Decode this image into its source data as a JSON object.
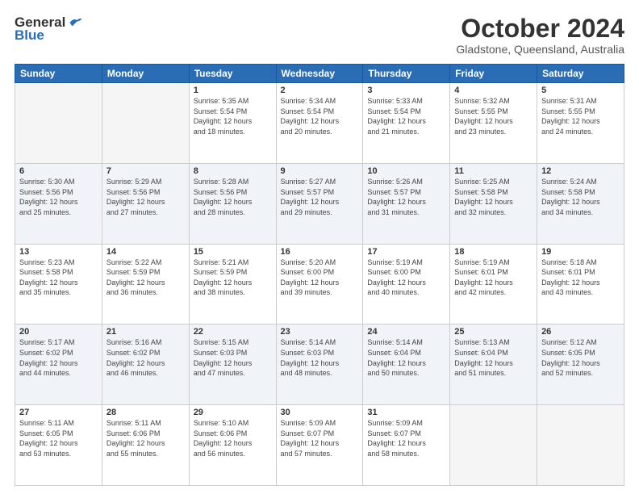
{
  "header": {
    "logo_general": "General",
    "logo_blue": "Blue",
    "month": "October 2024",
    "location": "Gladstone, Queensland, Australia"
  },
  "weekdays": [
    "Sunday",
    "Monday",
    "Tuesday",
    "Wednesday",
    "Thursday",
    "Friday",
    "Saturday"
  ],
  "weeks": [
    [
      {
        "day": "",
        "info": ""
      },
      {
        "day": "",
        "info": ""
      },
      {
        "day": "1",
        "info": "Sunrise: 5:35 AM\nSunset: 5:54 PM\nDaylight: 12 hours\nand 18 minutes."
      },
      {
        "day": "2",
        "info": "Sunrise: 5:34 AM\nSunset: 5:54 PM\nDaylight: 12 hours\nand 20 minutes."
      },
      {
        "day": "3",
        "info": "Sunrise: 5:33 AM\nSunset: 5:54 PM\nDaylight: 12 hours\nand 21 minutes."
      },
      {
        "day": "4",
        "info": "Sunrise: 5:32 AM\nSunset: 5:55 PM\nDaylight: 12 hours\nand 23 minutes."
      },
      {
        "day": "5",
        "info": "Sunrise: 5:31 AM\nSunset: 5:55 PM\nDaylight: 12 hours\nand 24 minutes."
      }
    ],
    [
      {
        "day": "6",
        "info": "Sunrise: 5:30 AM\nSunset: 5:56 PM\nDaylight: 12 hours\nand 25 minutes."
      },
      {
        "day": "7",
        "info": "Sunrise: 5:29 AM\nSunset: 5:56 PM\nDaylight: 12 hours\nand 27 minutes."
      },
      {
        "day": "8",
        "info": "Sunrise: 5:28 AM\nSunset: 5:56 PM\nDaylight: 12 hours\nand 28 minutes."
      },
      {
        "day": "9",
        "info": "Sunrise: 5:27 AM\nSunset: 5:57 PM\nDaylight: 12 hours\nand 29 minutes."
      },
      {
        "day": "10",
        "info": "Sunrise: 5:26 AM\nSunset: 5:57 PM\nDaylight: 12 hours\nand 31 minutes."
      },
      {
        "day": "11",
        "info": "Sunrise: 5:25 AM\nSunset: 5:58 PM\nDaylight: 12 hours\nand 32 minutes."
      },
      {
        "day": "12",
        "info": "Sunrise: 5:24 AM\nSunset: 5:58 PM\nDaylight: 12 hours\nand 34 minutes."
      }
    ],
    [
      {
        "day": "13",
        "info": "Sunrise: 5:23 AM\nSunset: 5:58 PM\nDaylight: 12 hours\nand 35 minutes."
      },
      {
        "day": "14",
        "info": "Sunrise: 5:22 AM\nSunset: 5:59 PM\nDaylight: 12 hours\nand 36 minutes."
      },
      {
        "day": "15",
        "info": "Sunrise: 5:21 AM\nSunset: 5:59 PM\nDaylight: 12 hours\nand 38 minutes."
      },
      {
        "day": "16",
        "info": "Sunrise: 5:20 AM\nSunset: 6:00 PM\nDaylight: 12 hours\nand 39 minutes."
      },
      {
        "day": "17",
        "info": "Sunrise: 5:19 AM\nSunset: 6:00 PM\nDaylight: 12 hours\nand 40 minutes."
      },
      {
        "day": "18",
        "info": "Sunrise: 5:19 AM\nSunset: 6:01 PM\nDaylight: 12 hours\nand 42 minutes."
      },
      {
        "day": "19",
        "info": "Sunrise: 5:18 AM\nSunset: 6:01 PM\nDaylight: 12 hours\nand 43 minutes."
      }
    ],
    [
      {
        "day": "20",
        "info": "Sunrise: 5:17 AM\nSunset: 6:02 PM\nDaylight: 12 hours\nand 44 minutes."
      },
      {
        "day": "21",
        "info": "Sunrise: 5:16 AM\nSunset: 6:02 PM\nDaylight: 12 hours\nand 46 minutes."
      },
      {
        "day": "22",
        "info": "Sunrise: 5:15 AM\nSunset: 6:03 PM\nDaylight: 12 hours\nand 47 minutes."
      },
      {
        "day": "23",
        "info": "Sunrise: 5:14 AM\nSunset: 6:03 PM\nDaylight: 12 hours\nand 48 minutes."
      },
      {
        "day": "24",
        "info": "Sunrise: 5:14 AM\nSunset: 6:04 PM\nDaylight: 12 hours\nand 50 minutes."
      },
      {
        "day": "25",
        "info": "Sunrise: 5:13 AM\nSunset: 6:04 PM\nDaylight: 12 hours\nand 51 minutes."
      },
      {
        "day": "26",
        "info": "Sunrise: 5:12 AM\nSunset: 6:05 PM\nDaylight: 12 hours\nand 52 minutes."
      }
    ],
    [
      {
        "day": "27",
        "info": "Sunrise: 5:11 AM\nSunset: 6:05 PM\nDaylight: 12 hours\nand 53 minutes."
      },
      {
        "day": "28",
        "info": "Sunrise: 5:11 AM\nSunset: 6:06 PM\nDaylight: 12 hours\nand 55 minutes."
      },
      {
        "day": "29",
        "info": "Sunrise: 5:10 AM\nSunset: 6:06 PM\nDaylight: 12 hours\nand 56 minutes."
      },
      {
        "day": "30",
        "info": "Sunrise: 5:09 AM\nSunset: 6:07 PM\nDaylight: 12 hours\nand 57 minutes."
      },
      {
        "day": "31",
        "info": "Sunrise: 5:09 AM\nSunset: 6:07 PM\nDaylight: 12 hours\nand 58 minutes."
      },
      {
        "day": "",
        "info": ""
      },
      {
        "day": "",
        "info": ""
      }
    ]
  ]
}
